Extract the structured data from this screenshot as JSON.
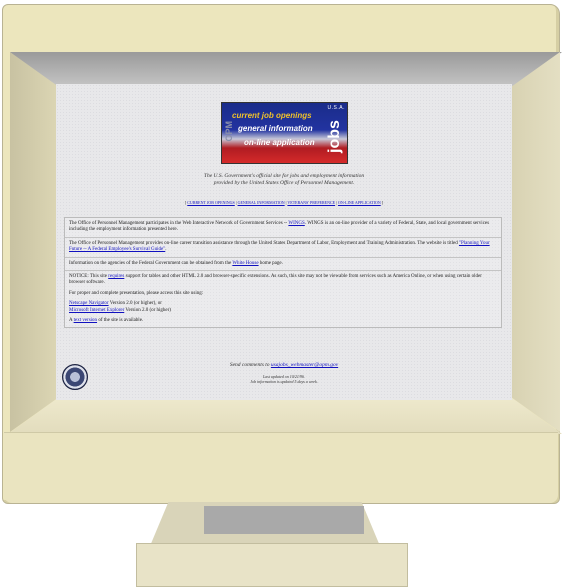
{
  "banner": {
    "usa": "U.S.A.",
    "jobs": "jobs",
    "opm": "OPM",
    "line1": "current job openings",
    "line2": "general information",
    "line3": "on-line application"
  },
  "tagline": {
    "line1": "The U.S. Government's official site for jobs and employment information",
    "line2": "provided by the United States Office of Personnel Management."
  },
  "nav": {
    "items": [
      "CURRENT JOB OPENINGS",
      "GENERAL INFORMATION",
      "VETERANS' PREFERENCE",
      "ON-LINE APPLICATION"
    ],
    "separator": " | "
  },
  "content": {
    "p1_before": "The Office of Personnel Management participates in the Web Interactive Network of Government Services -- ",
    "p1_link": "WINGS",
    "p1_after": ". WINGS is an on-line provider of a variety of Federal, State, and local government services including the employment information presented here.",
    "p2_before": "The Office of Personnel Management provides on-line career transition assistance through the United States Department of Labor, Employment and Training Administration. The website is titled ",
    "p2_link": "\"Planning Your Future -- A Federal Employee's Survival Guide\"",
    "p2_after": ".",
    "p3_before": "Information on the agencies of the Federal Government can be obtained from the ",
    "p3_link": "White House",
    "p3_after": " home page.",
    "notice_before": "NOTICE: This site ",
    "notice_link": "requires",
    "notice_after": " support for tables and other HTML 2.0 and browser-specific extensions. As such, this site may not be viewable from services such as America Online, or when using certain older browser software.",
    "proper": "For proper and complete presentation, please access this site using:",
    "netscape_link": "Netscape Navigator",
    "netscape_after": " Version 2.0 (or higher), or",
    "ie_link": "Microsoft Internet Explorer",
    "ie_after": " Version 2.0 (or higher)",
    "text_before": "A ",
    "text_link": "text version",
    "text_after": " of the site is available."
  },
  "footer": {
    "send_before": "Send comments to ",
    "send_link": "usajobs_webmaster@opm.gov",
    "updated": "Last updated on 10/21/96.",
    "job_info": "Job information is updated 5 days a week."
  },
  "colors": {
    "bezel": "#ece6bd",
    "screen": "#e8e8ea",
    "link": "#1010c0"
  }
}
